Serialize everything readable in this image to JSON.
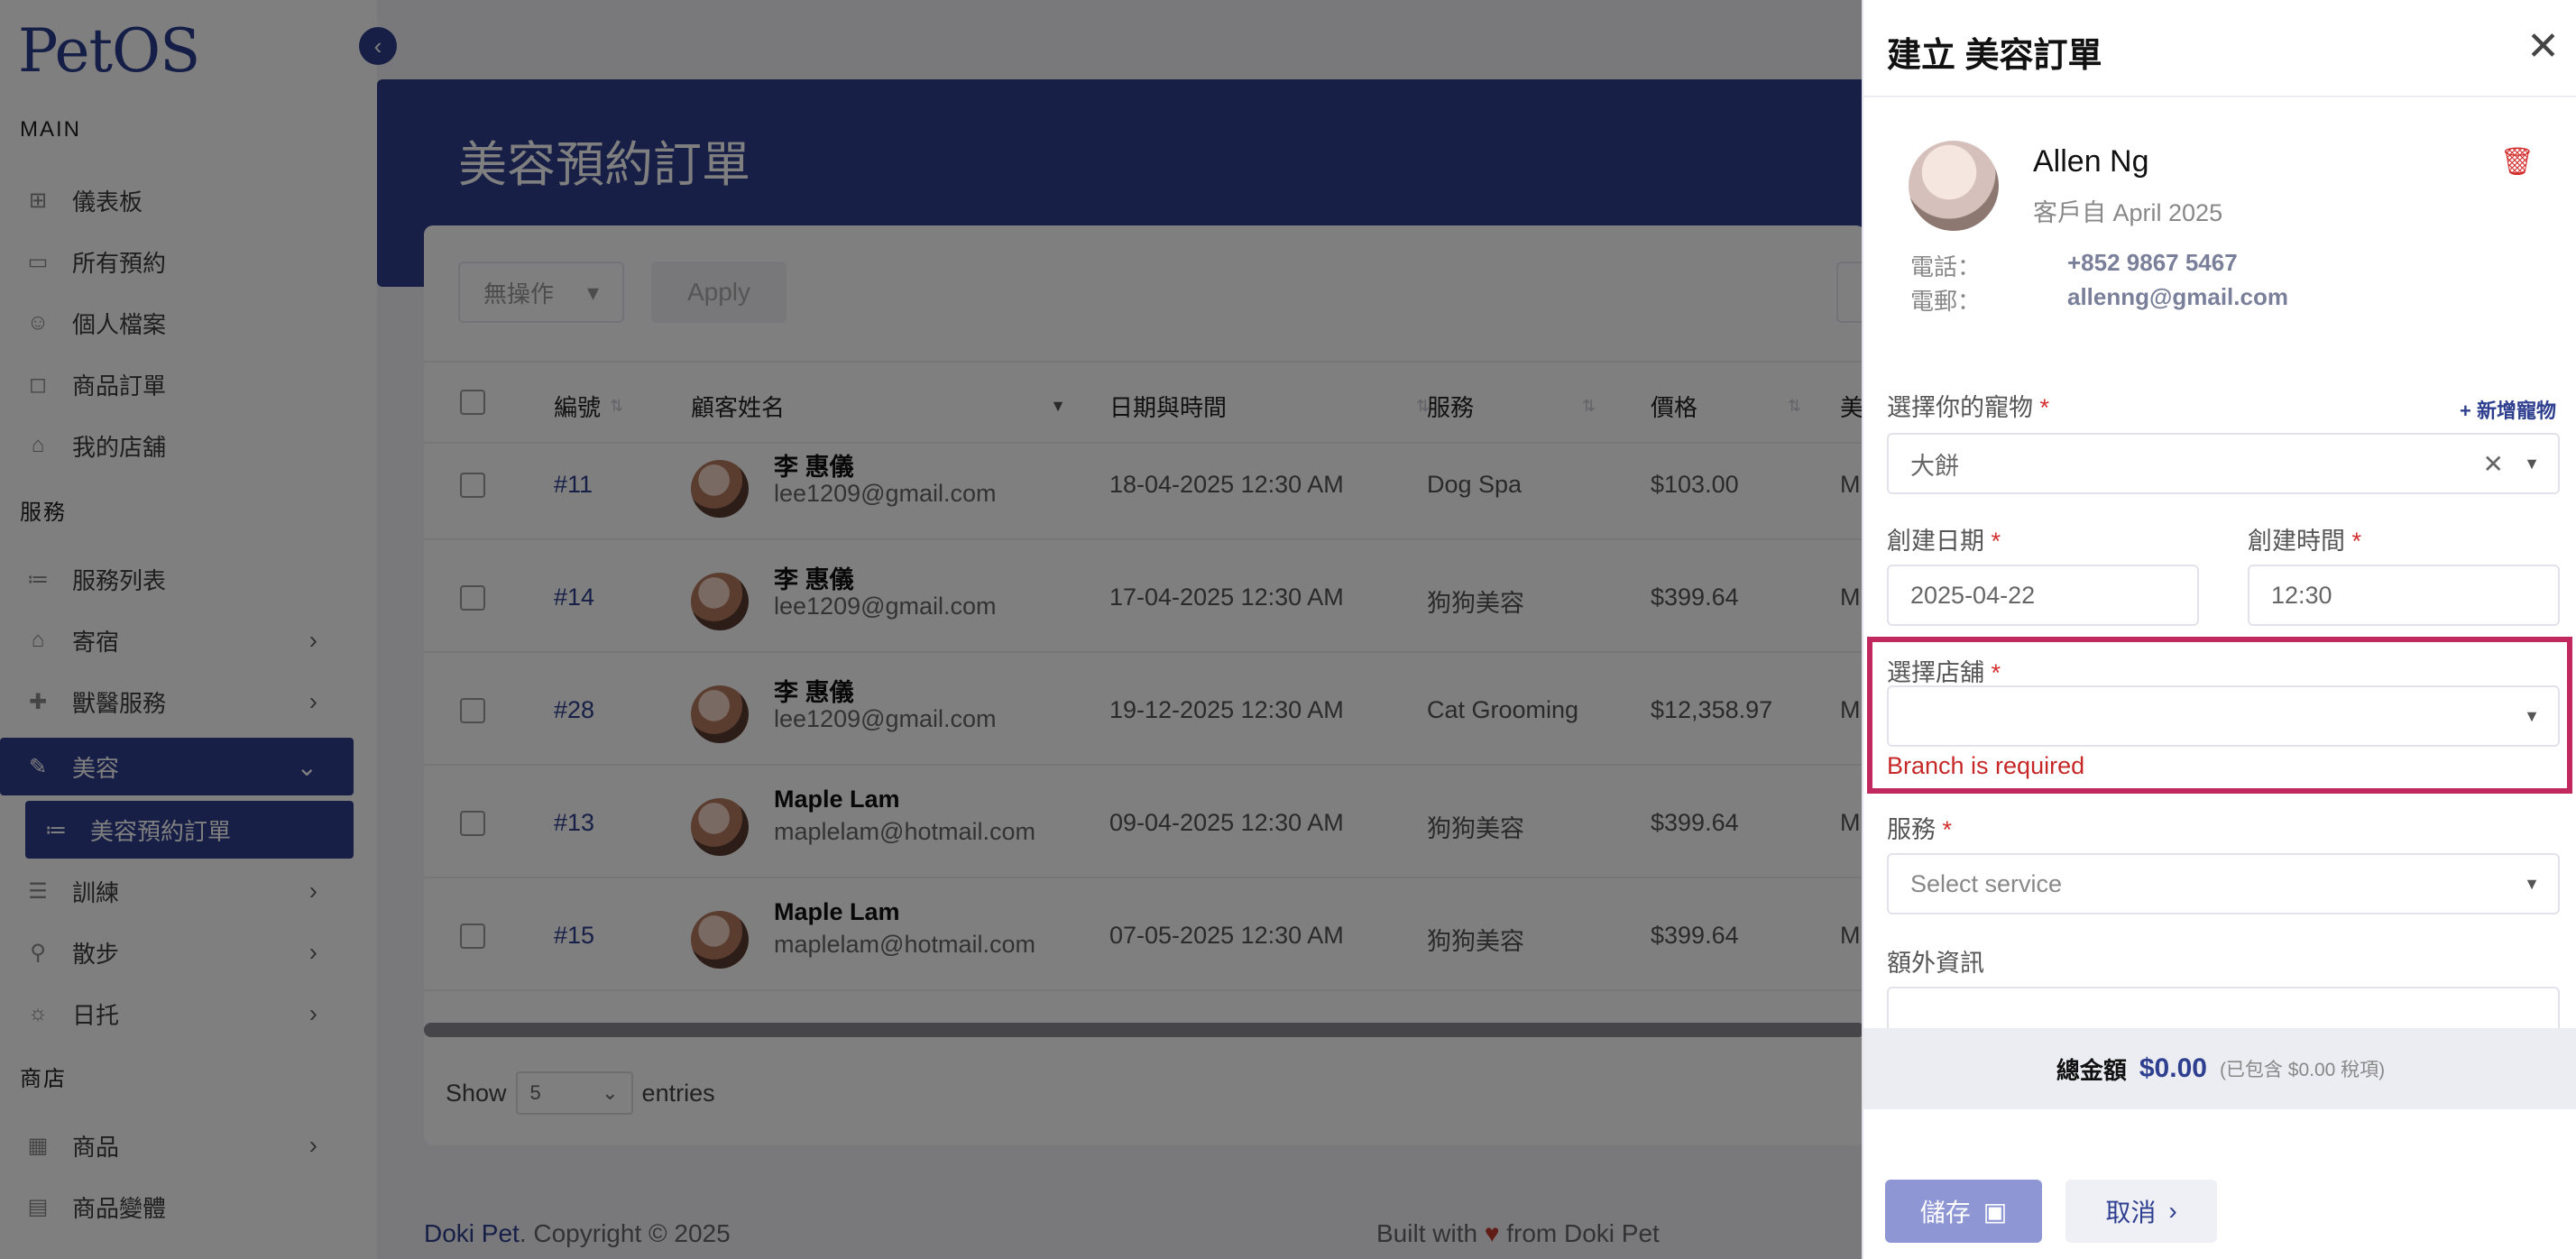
{
  "app": {
    "logo": "PetOS"
  },
  "sidebar": {
    "sections": {
      "main": "MAIN",
      "services": "服務",
      "shop": "商店"
    },
    "items": [
      {
        "label": "儀表板",
        "icon": "dashboard-icon"
      },
      {
        "label": "所有預約",
        "icon": "calendar-icon"
      },
      {
        "label": "個人檔案",
        "icon": "user-icon"
      },
      {
        "label": "商品訂單",
        "icon": "bag-icon"
      },
      {
        "label": "我的店舖",
        "icon": "store-icon"
      },
      {
        "label": "服務列表",
        "icon": "list-icon"
      },
      {
        "label": "寄宿",
        "icon": "house-icon"
      },
      {
        "label": "獸醫服務",
        "icon": "vet-icon"
      },
      {
        "label": "美容",
        "icon": "brush-icon"
      },
      {
        "label": "美容預約訂單",
        "icon": "list-icon"
      },
      {
        "label": "訓練",
        "icon": "training-icon"
      },
      {
        "label": "散步",
        "icon": "walk-icon"
      },
      {
        "label": "日托",
        "icon": "daycare-icon"
      },
      {
        "label": "商品",
        "icon": "product-icon"
      },
      {
        "label": "商品變體",
        "icon": "variant-icon"
      }
    ]
  },
  "page": {
    "title": "美容預約訂單"
  },
  "toolbar": {
    "bulk_action": "無操作",
    "apply": "Apply"
  },
  "table": {
    "headers": [
      "編號",
      "顧客姓名",
      "日期與時間",
      "服務",
      "價格",
      "美"
    ],
    "rows": [
      {
        "id": "#11",
        "name": "李 惠儀",
        "email": "lee1209@gmail.com",
        "datetime": "18-04-2025 12:30 AM",
        "service": "Dog Spa",
        "price": "$103.00",
        "extra": "M"
      },
      {
        "id": "#14",
        "name": "李 惠儀",
        "email": "lee1209@gmail.com",
        "datetime": "17-04-2025 12:30 AM",
        "service": "狗狗美容",
        "price": "$399.64",
        "extra": "M"
      },
      {
        "id": "#28",
        "name": "李 惠儀",
        "email": "lee1209@gmail.com",
        "datetime": "19-12-2025 12:30 AM",
        "service": "Cat Grooming",
        "price": "$12,358.97",
        "extra": "M"
      },
      {
        "id": "#13",
        "name": "Maple Lam",
        "email": "maplelam@hotmail.com",
        "datetime": "09-04-2025 12:30 AM",
        "service": "狗狗美容",
        "price": "$399.64",
        "extra": "M"
      },
      {
        "id": "#15",
        "name": "Maple Lam",
        "email": "maplelam@hotmail.com",
        "datetime": "07-05-2025 12:30 AM",
        "service": "狗狗美容",
        "price": "$399.64",
        "extra": "M"
      }
    ],
    "show_label": "Show",
    "show_value": "5",
    "entries_label": "entries"
  },
  "footer": {
    "brand": "Doki Pet",
    "copyright": ". Copyright © 2025",
    "built_with": "Built with",
    "built_from": "from Doki Pet"
  },
  "drawer": {
    "title": "建立 美容訂單",
    "customer": {
      "name": "Allen Ng",
      "since": "客戶自 April 2025",
      "phone_label": "電話：",
      "phone": "+852 9867 5467",
      "email_label": "電郵：",
      "email": "allenng@gmail.com"
    },
    "pet_label": "選擇你的寵物",
    "add_pet": "+ 新增寵物",
    "pet_value": "大餅",
    "date_label": "創建日期",
    "date_value": "2025-04-22",
    "time_label": "創建時間",
    "time_value": "12:30",
    "branch_label": "選擇店舖",
    "branch_value": "",
    "branch_error": "Branch is required",
    "service_label": "服務",
    "service_placeholder": "Select service",
    "extra_label": "額外資訊",
    "total_label": "總金額",
    "total_value": "$0.00",
    "total_note": "(已包含 $0.00 稅項)",
    "save": "儲存",
    "cancel": "取消",
    "required_mark": "*"
  },
  "colors": {
    "primary": "#2f3f8f",
    "error": "#c62828",
    "highlight": "#c0285e"
  }
}
